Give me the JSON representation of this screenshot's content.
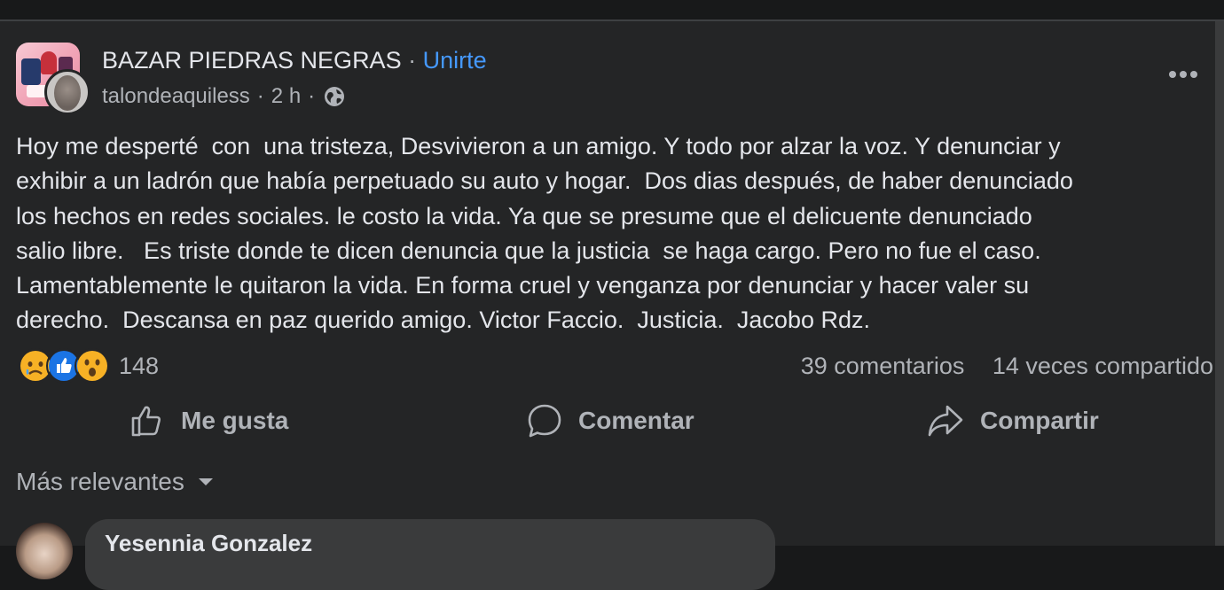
{
  "post": {
    "group_name": "BAZAR PIEDRAS NEGRAS",
    "separator": "·",
    "join_label": "Unirte",
    "author": "talondeaquiless",
    "time": "2 h",
    "time_separator": "·",
    "privacy_icon": "globe-icon",
    "more_icon": "more-horizontal-icon",
    "text": "Hoy me desperté  con  una tristeza, Desvivieron a un amigo. Y todo por alzar la voz. Y denunciar y\nexhibir a un ladrón que había perpetuado su auto y hogar.  Dos dias después, de haber denunciado\nlos hechos en redes sociales. le costo la vida. Ya que se presume que el delicuente denunciado\nsalio libre.   Es triste donde te dicen denuncia que la justicia  se haga cargo. Pero no fue el caso.\nLamentablemente le quitaron la vida. En forma cruel y venganza por denunciar y hacer valer su\nderecho.  Descansa en paz querido amigo. Victor Faccio.  Justicia.  Jacobo Rdz."
  },
  "reactions": {
    "icons": [
      "sad-reaction-icon",
      "like-reaction-icon",
      "wow-reaction-icon"
    ],
    "count": "148",
    "comments": "39 comentarios",
    "shares": "14 veces compartido"
  },
  "actions": {
    "like": "Me gusta",
    "comment": "Comentar",
    "share": "Compartir"
  },
  "comments": {
    "sort_label": "Más relevantes",
    "first_commenter": "Yesennia Gonzalez"
  },
  "colors": {
    "background": "#18191a",
    "card": "#242526",
    "text_primary": "#e4e6eb",
    "text_secondary": "#b0b3b8",
    "accent_link": "#4599ff",
    "like_blue": "#1b74e4",
    "reaction_yellow": "#f7b125"
  }
}
